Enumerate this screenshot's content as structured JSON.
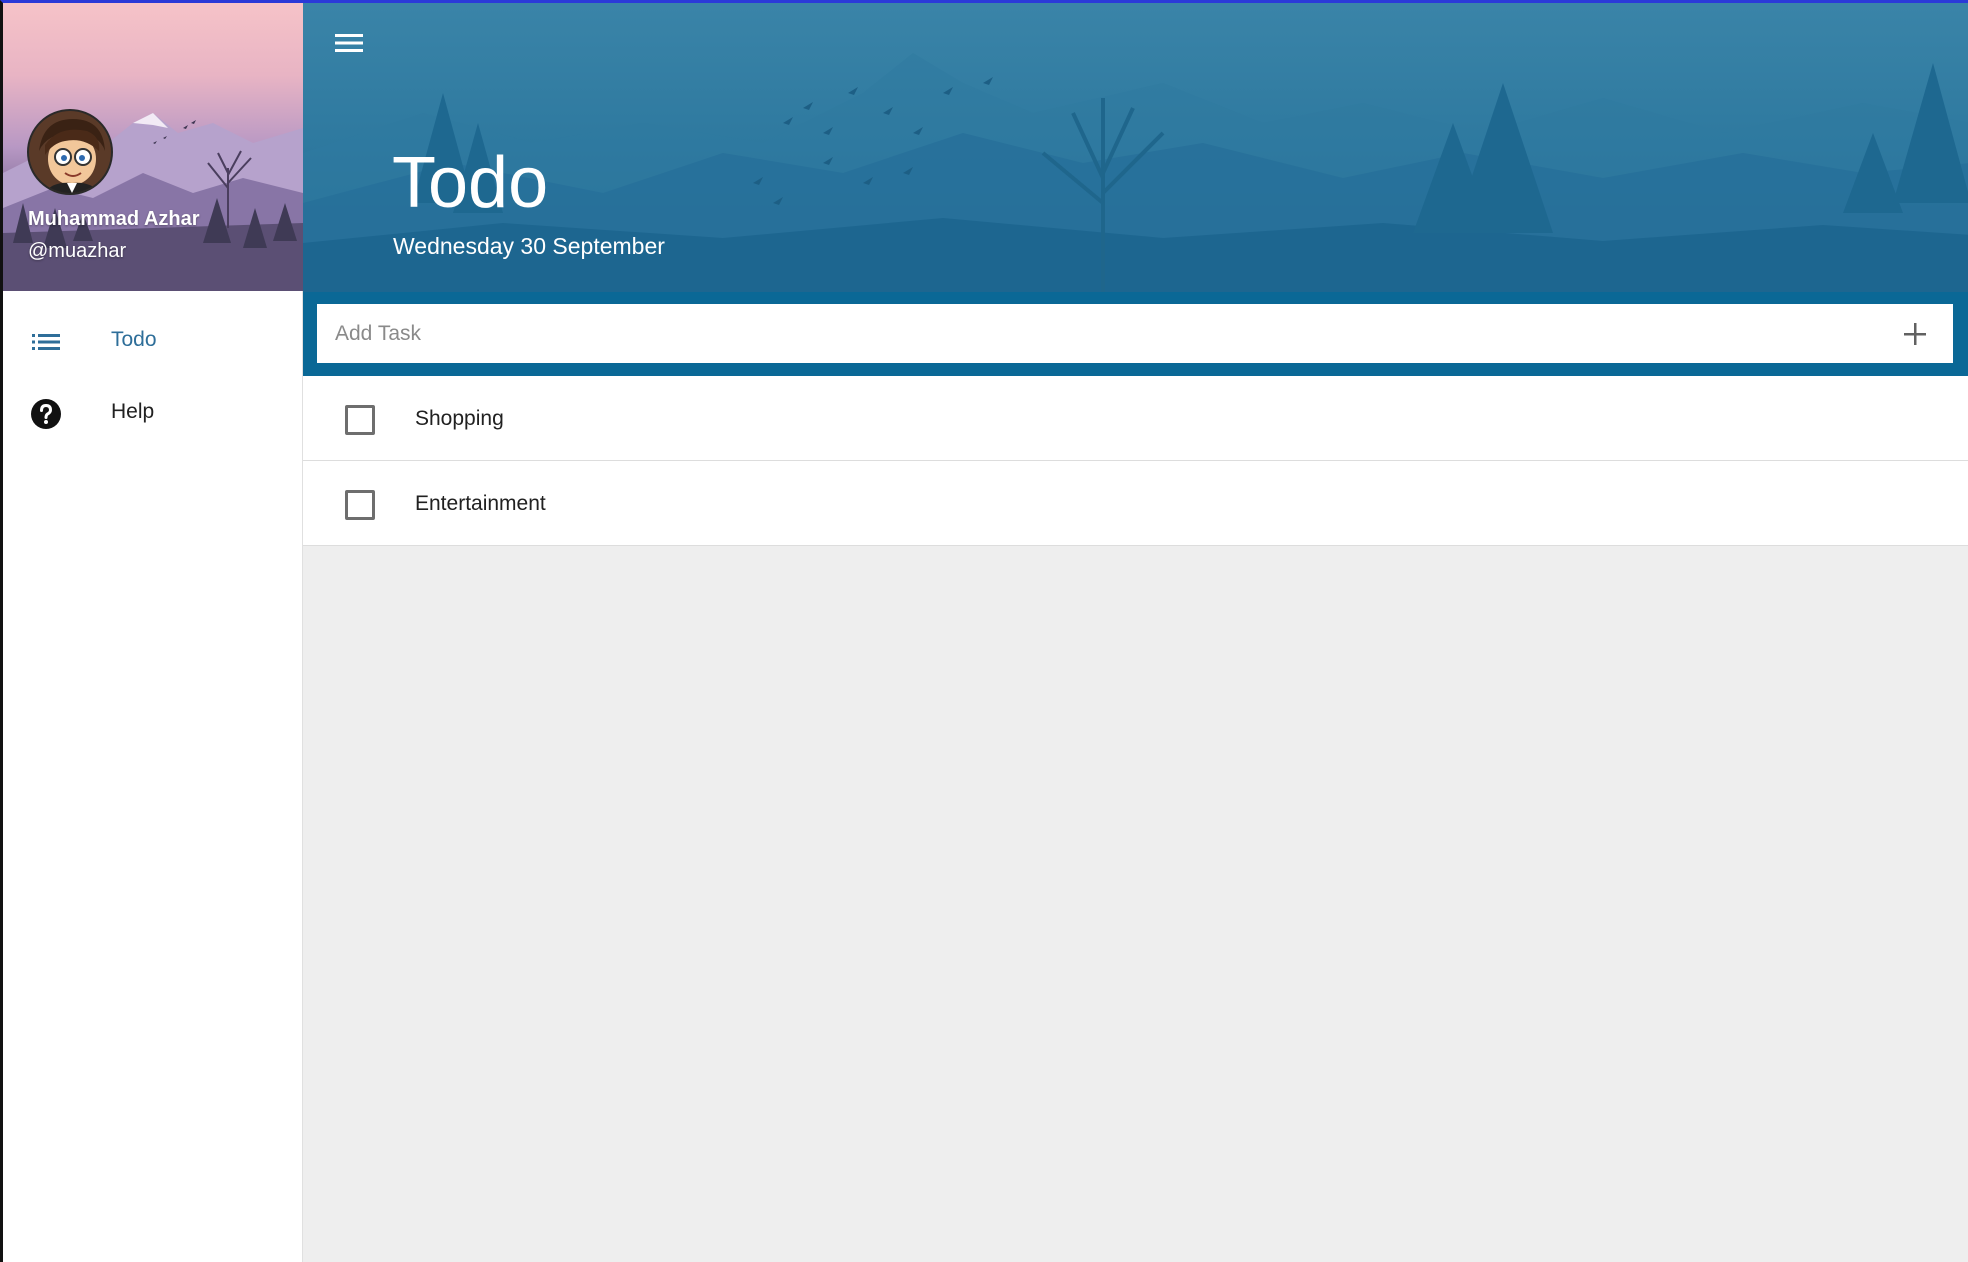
{
  "profile": {
    "name": "Muhammad Azhar",
    "handle": "@muazhar"
  },
  "nav": {
    "items": [
      {
        "label": "Todo",
        "icon": "list-icon",
        "active": true
      },
      {
        "label": "Help",
        "icon": "help-circle-icon",
        "active": false
      }
    ]
  },
  "header": {
    "title": "Todo",
    "date": "Wednesday 30 September",
    "menu_icon": "hamburger-menu-icon"
  },
  "add_task": {
    "placeholder": "Add Task",
    "value": "",
    "button_icon": "plus-icon"
  },
  "tasks": [
    {
      "label": "Shopping",
      "checked": false
    },
    {
      "label": "Entertainment",
      "checked": false
    }
  ],
  "colors": {
    "header_blue": "#2f7aa0",
    "add_bar_blue": "#0a6896",
    "active_nav": "#2e6e99",
    "background": "#eeeeee"
  }
}
